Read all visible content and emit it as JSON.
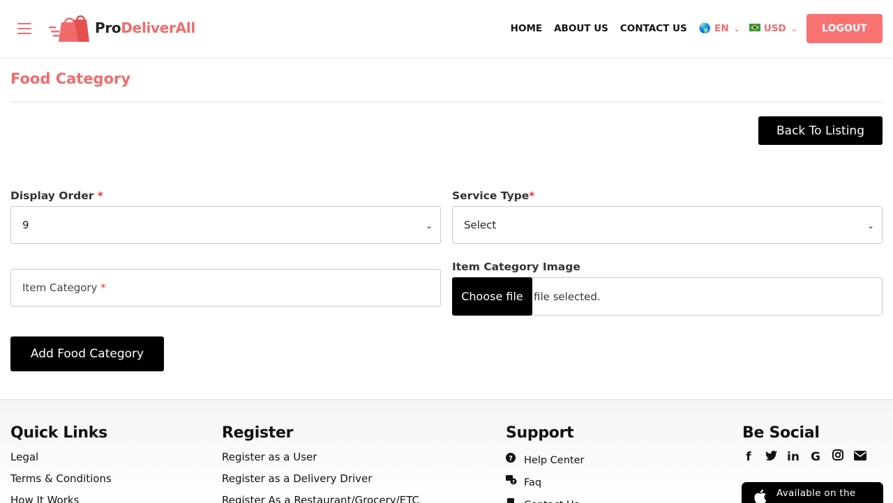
{
  "header": {
    "logo_pro": "Pro",
    "logo_rest": "DeliverAll",
    "nav": [
      "HOME",
      "ABOUT US",
      "CONTACT US"
    ],
    "language": "EN",
    "currency": "USD",
    "logout_label": "LOGOUT"
  },
  "page": {
    "title": "Food Category",
    "back_label": "Back To Listing"
  },
  "form": {
    "display_order_label": "Display Order",
    "display_order_value": "9",
    "service_type_label": "Service Type",
    "service_type_value": "Select",
    "item_category_placeholder": "Item Category",
    "item_category_image_label": "Item Category Image",
    "choose_file_label": "Choose file",
    "file_status": "file selected.",
    "required_mark": "*",
    "submit_label": "Add Food Category"
  },
  "footer": {
    "quick_links": {
      "title": "Quick Links",
      "items": [
        "Legal",
        "Terms & Conditions",
        "How It Works"
      ]
    },
    "register": {
      "title": "Register",
      "items": [
        "Register as a User",
        "Register as a Delivery Driver",
        "Register As a Restaurant/Grocery/ETC"
      ]
    },
    "support": {
      "title": "Support",
      "items": [
        "Help Center",
        "Faq",
        "Contact Us"
      ]
    },
    "social": {
      "title": "Be Social",
      "icons": [
        "facebook-icon",
        "twitter-icon",
        "linkedin-icon",
        "google-icon",
        "instagram-icon",
        "email-icon"
      ]
    },
    "appstore_label": "Available on the"
  },
  "colors": {
    "brand": "#f26b6b",
    "logout_bg": "#f87272",
    "button_dark": "#000000"
  }
}
